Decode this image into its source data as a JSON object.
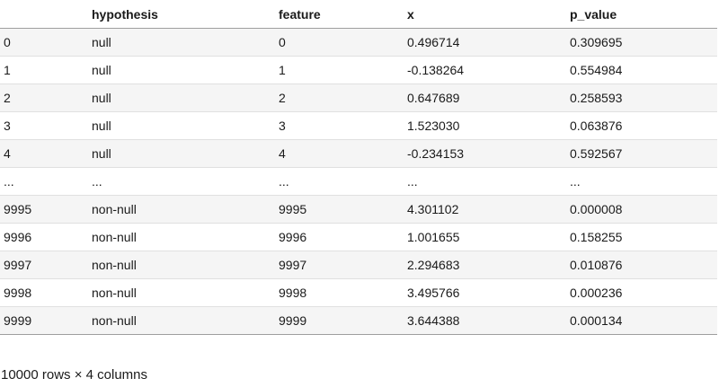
{
  "table": {
    "columns": [
      "",
      "hypothesis",
      "feature",
      "x",
      "p_value"
    ],
    "rows": [
      [
        "0",
        "null",
        "0",
        "0.496714",
        "0.309695"
      ],
      [
        "1",
        "null",
        "1",
        "-0.138264",
        "0.554984"
      ],
      [
        "2",
        "null",
        "2",
        "0.647689",
        "0.258593"
      ],
      [
        "3",
        "null",
        "3",
        "1.523030",
        "0.063876"
      ],
      [
        "4",
        "null",
        "4",
        "-0.234153",
        "0.592567"
      ],
      [
        "...",
        "...",
        "...",
        "...",
        "..."
      ],
      [
        "9995",
        "non-null",
        "9995",
        "4.301102",
        "0.000008"
      ],
      [
        "9996",
        "non-null",
        "9996",
        "1.001655",
        "0.158255"
      ],
      [
        "9997",
        "non-null",
        "9997",
        "2.294683",
        "0.010876"
      ],
      [
        "9998",
        "non-null",
        "9998",
        "3.495766",
        "0.000236"
      ],
      [
        "9999",
        "non-null",
        "9999",
        "3.644388",
        "0.000134"
      ]
    ]
  },
  "footer": {
    "shape_text": "10000 rows × 4 columns"
  }
}
